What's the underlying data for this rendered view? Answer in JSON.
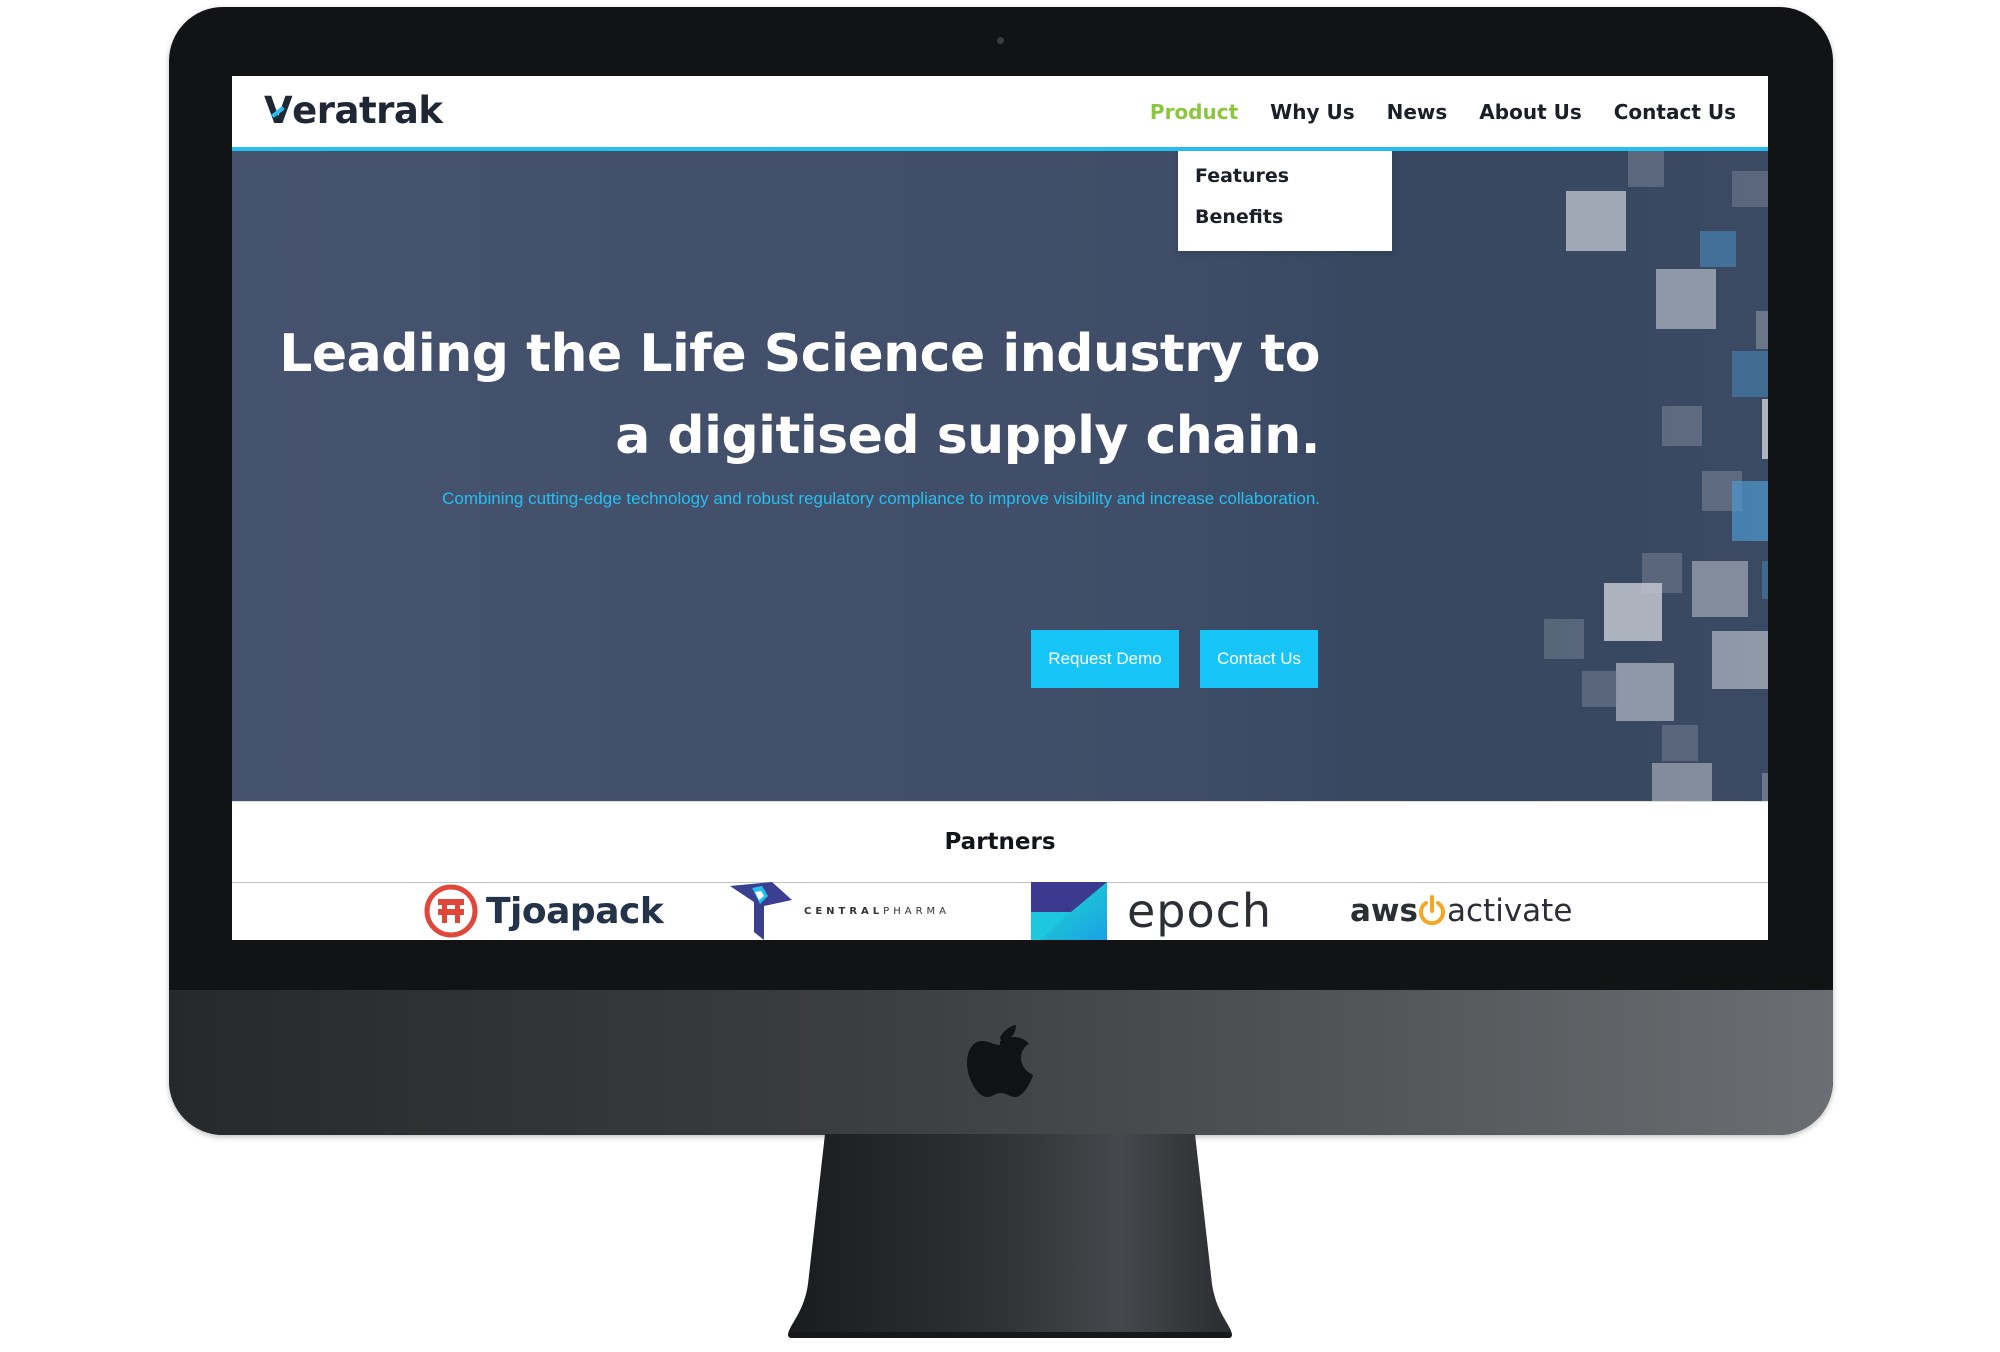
{
  "brand": {
    "logo_prefix": "V",
    "logo_rest": "eratrak",
    "accent": "#27bff0",
    "nav_active_color": "#8cc63f"
  },
  "nav": {
    "items": [
      "Product",
      "Why Us",
      "News",
      "About Us",
      "Contact Us"
    ],
    "active": "Product"
  },
  "dropdown": {
    "items": [
      "Features",
      "Benefits"
    ]
  },
  "hero": {
    "title_line1": "Leading the Life Science industry to",
    "title_line2": "a digitised supply chain.",
    "subtitle": "Combining cutting-edge technology and robust regulatory compliance to improve visibility and increase collaboration.",
    "buttons": {
      "demo": "Request Demo",
      "contact": "Contact Us"
    }
  },
  "partners": {
    "title": "Partners",
    "logos": {
      "tjoapack": "Tjoapack",
      "centralpharma_a": "CENTRAL",
      "centralpharma_b": "PHARMA",
      "epoch": "epoch",
      "aws_a": "aws",
      "aws_b": "activate"
    }
  },
  "icons": [
    "apple-logo-icon",
    "tjoapack-mark-icon",
    "centralpharma-mark-icon",
    "epoch-mark-icon",
    "aws-power-icon"
  ]
}
